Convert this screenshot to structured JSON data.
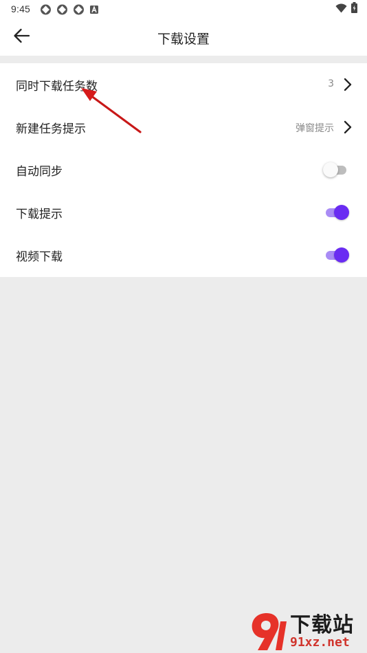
{
  "status_bar": {
    "time": "9:45",
    "left_icons": [
      "aperture-icon",
      "aperture-icon",
      "aperture-icon",
      "a-square-icon"
    ],
    "right_icons": [
      "wifi-icon",
      "battery-icon"
    ]
  },
  "header": {
    "title": "下载设置",
    "back_icon": "arrow-left-icon"
  },
  "settings": {
    "items": [
      {
        "label": "同时下载任务数",
        "value": "3",
        "control": "chevron"
      },
      {
        "label": "新建任务提示",
        "value": "弹窗提示",
        "control": "chevron"
      },
      {
        "label": "自动同步",
        "control": "switch",
        "on": false
      },
      {
        "label": "下载提示",
        "control": "switch",
        "on": true
      },
      {
        "label": "视频下载",
        "control": "switch",
        "on": true
      }
    ]
  },
  "colors": {
    "accent": "#6a2cf2",
    "accent_track": "#a98cf5",
    "annotation_arrow": "#e02020",
    "background": "#ececec"
  },
  "watermark": {
    "title": "下载站",
    "domain": "91xz.net"
  }
}
